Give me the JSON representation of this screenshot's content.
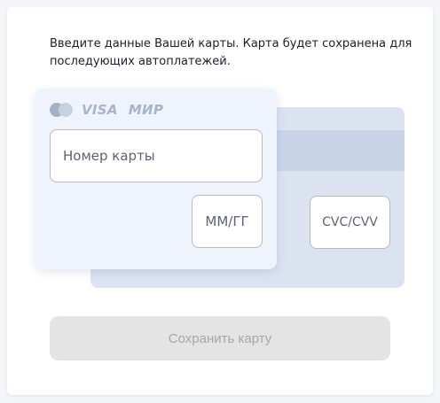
{
  "intro": {
    "line1": "Введите данные Вашей карты. Карта будет сохранена для",
    "line2": "последующих автоплатежей."
  },
  "brands": {
    "visa": "VISA",
    "mir": "МИР",
    "icons": [
      "mastercard-icon",
      "visa-logo",
      "mir-logo"
    ]
  },
  "fields": {
    "card_number_placeholder": "Номер карты",
    "expiry_placeholder": "ММ/ГГ",
    "cvc_placeholder": "CVC/CVV"
  },
  "save_button": {
    "label": "Сохранить карту",
    "state": "disabled"
  },
  "colors": {
    "card_front": "#eef3fc",
    "card_back": "#dbe3f1",
    "button_disabled_bg": "#e4e4e4",
    "button_disabled_text": "#a7a7a7"
  }
}
